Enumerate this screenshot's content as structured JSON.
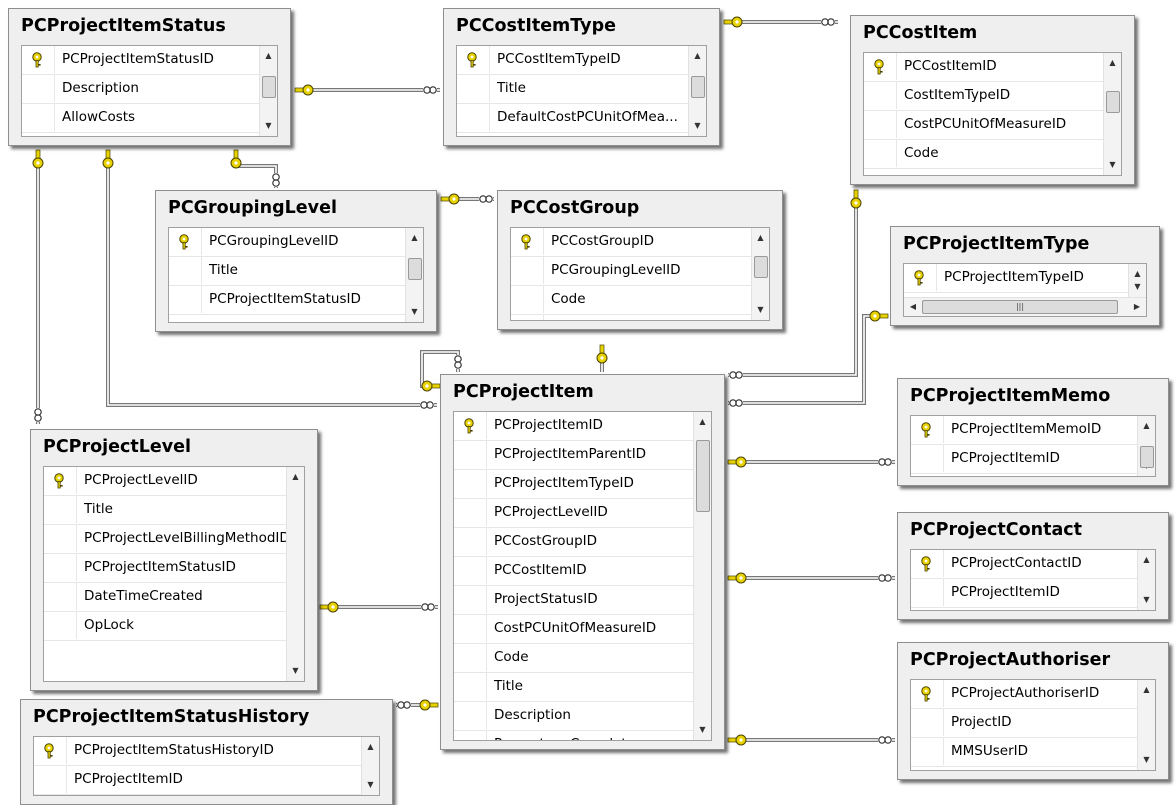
{
  "tables": [
    {
      "key": "pcprojectitemstatus",
      "title": "PCProjectItemStatus",
      "columns": [
        {
          "name": "PCProjectItemStatusID",
          "pk": true
        },
        {
          "name": "Description"
        },
        {
          "name": "AllowCosts"
        }
      ]
    },
    {
      "key": "pccostitemtype",
      "title": "PCCostItemType",
      "columns": [
        {
          "name": "PCCostItemTypeID",
          "pk": true
        },
        {
          "name": "Title"
        },
        {
          "name": "DefaultCostPCUnitOfMea..."
        }
      ]
    },
    {
      "key": "pccostitem",
      "title": "PCCostItem",
      "columns": [
        {
          "name": "PCCostItemID",
          "pk": true
        },
        {
          "name": "CostItemTypeID"
        },
        {
          "name": "CostPCUnitOfMeasureID"
        },
        {
          "name": "Code"
        }
      ]
    },
    {
      "key": "pcgroupinglevel",
      "title": "PCGroupingLevel",
      "columns": [
        {
          "name": "PCGroupingLevelID",
          "pk": true
        },
        {
          "name": "Title"
        },
        {
          "name": "PCProjectItemStatusID"
        }
      ]
    },
    {
      "key": "pccostgroup",
      "title": "PCCostGroup",
      "columns": [
        {
          "name": "PCCostGroupID",
          "pk": true
        },
        {
          "name": "PCGroupingLevelID"
        },
        {
          "name": "Code"
        },
        {
          "name": "Title"
        }
      ]
    },
    {
      "key": "pcprojectitemtype",
      "title": "PCProjectItemType",
      "columns": [
        {
          "name": "PCProjectItemTypeID",
          "pk": true
        }
      ]
    },
    {
      "key": "pcprojectitem",
      "title": "PCProjectItem",
      "columns": [
        {
          "name": "PCProjectItemID",
          "pk": true
        },
        {
          "name": "PCProjectItemParentID"
        },
        {
          "name": "PCProjectItemTypeID"
        },
        {
          "name": "PCProjectLevelID"
        },
        {
          "name": "PCCostGroupID"
        },
        {
          "name": "PCCostItemID"
        },
        {
          "name": "ProjectStatusID"
        },
        {
          "name": "CostPCUnitOfMeasureID"
        },
        {
          "name": "Code"
        },
        {
          "name": "Title"
        },
        {
          "name": "Description"
        },
        {
          "name": "PercentageComplete"
        }
      ]
    },
    {
      "key": "pcprojectitemmemo",
      "title": "PCProjectItemMemo",
      "columns": [
        {
          "name": "PCProjectItemMemoID",
          "pk": true
        },
        {
          "name": "PCProjectItemID"
        }
      ]
    },
    {
      "key": "pcprojectlevel",
      "title": "PCProjectLevel",
      "columns": [
        {
          "name": "PCProjectLevelID",
          "pk": true
        },
        {
          "name": "Title"
        },
        {
          "name": "PCProjectLevelBillingMethodID"
        },
        {
          "name": "PCProjectItemStatusID"
        },
        {
          "name": "DateTimeCreated"
        },
        {
          "name": "OpLock"
        }
      ]
    },
    {
      "key": "pcprojectcontact",
      "title": "PCProjectContact",
      "columns": [
        {
          "name": "PCProjectContactID",
          "pk": true
        },
        {
          "name": "PCProjectItemID"
        }
      ]
    },
    {
      "key": "pcprojectauthoriser",
      "title": "PCProjectAuthoriser",
      "columns": [
        {
          "name": "PCProjectAuthoriserID",
          "pk": true
        },
        {
          "name": "ProjectID"
        },
        {
          "name": "MMSUserID"
        }
      ]
    },
    {
      "key": "pcprojectitemstatushistory",
      "title": "PCProjectItemStatusHistory",
      "columns": [
        {
          "name": "PCProjectItemStatusHistoryID",
          "pk": true
        },
        {
          "name": "PCProjectItemID"
        }
      ]
    }
  ],
  "relationships": [
    {
      "name": "pcprojectitemstatus-to-pccostitemtype"
    },
    {
      "name": "pccostitemtype-to-pccostitem"
    },
    {
      "name": "pcprojectitemstatus-to-pcprojectlevel"
    },
    {
      "name": "pcprojectitemstatus-to-pcprojectitem"
    },
    {
      "name": "pcprojectitemstatus-to-pcgroupinglevel"
    },
    {
      "name": "pcgroupinglevel-to-pccostgroup"
    },
    {
      "name": "pcprojectitem-self-parent"
    },
    {
      "name": "pccostgroup-to-pcprojectitem"
    },
    {
      "name": "pccostitem-to-pcprojectitem"
    },
    {
      "name": "pcprojectitemtype-to-pcprojectitem"
    },
    {
      "name": "pcprojectitem-to-pcprojectitemmemo"
    },
    {
      "name": "pcprojectlevel-to-pcprojectitem"
    },
    {
      "name": "pcprojectitem-to-pcprojectcontact"
    },
    {
      "name": "pcprojectitem-to-pcprojectitemstatushistory"
    },
    {
      "name": "pcprojectitem-to-pcprojectauthoriser"
    }
  ],
  "colors": {
    "key_icon": "#e8d200",
    "connector": "#555555",
    "title_bg": "#efefef"
  }
}
